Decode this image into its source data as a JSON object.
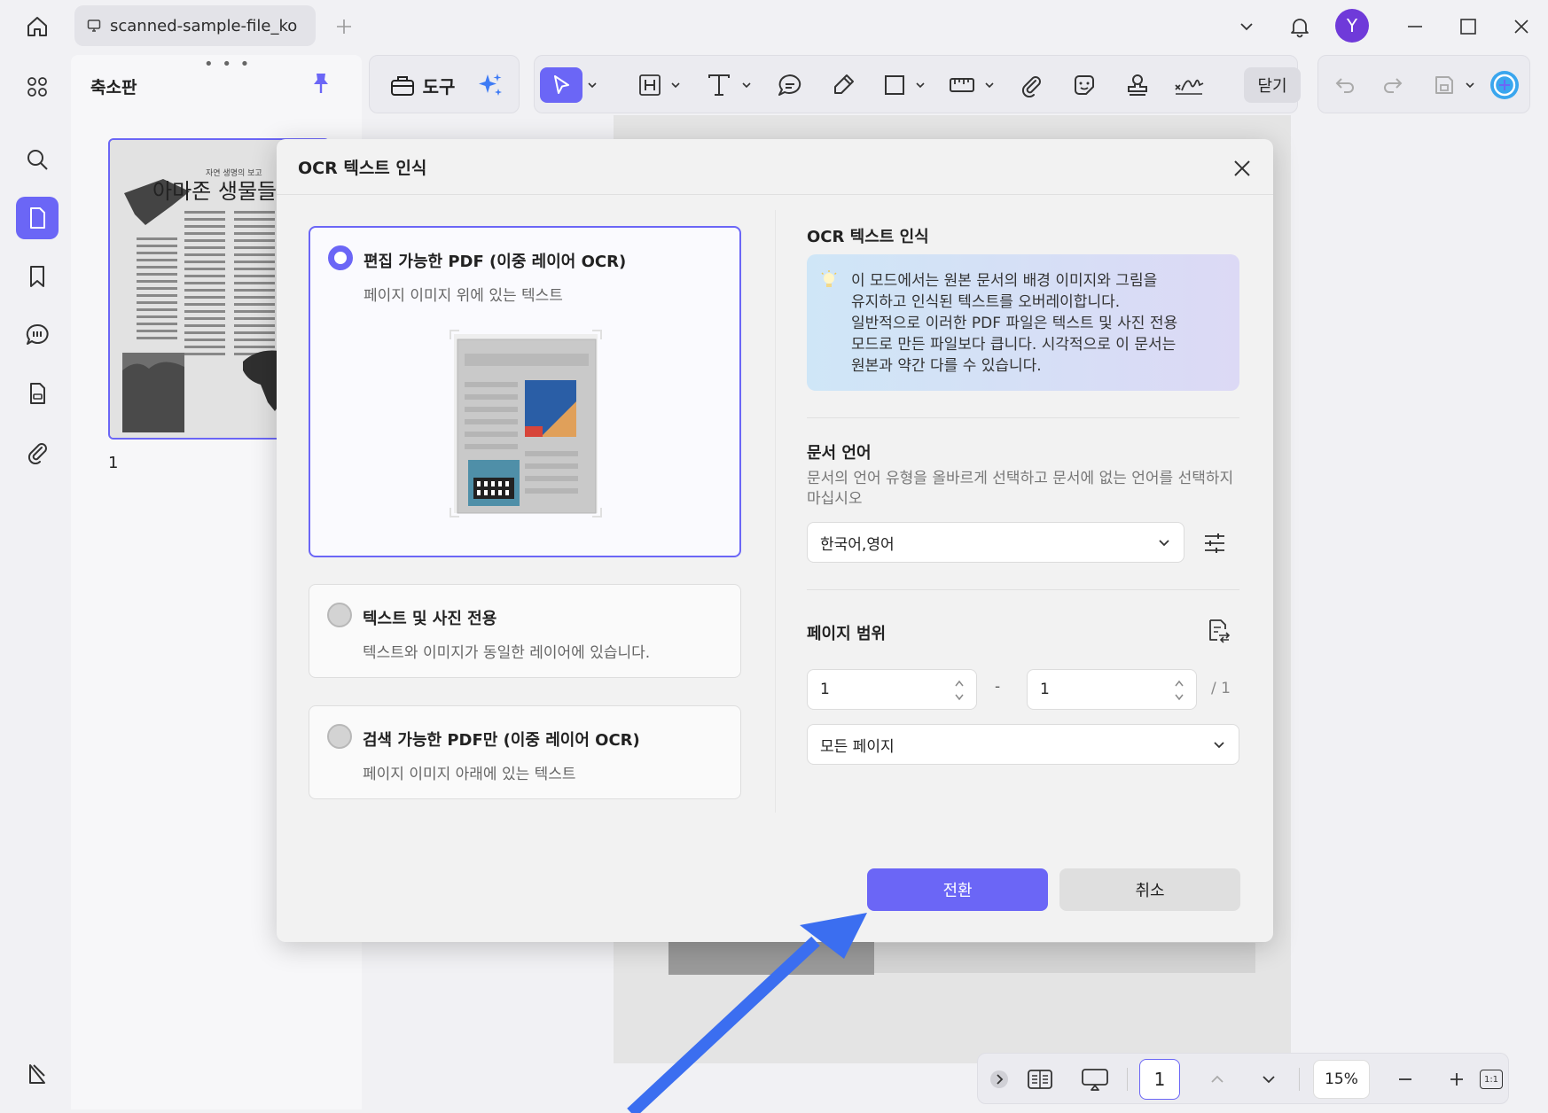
{
  "titlebar": {
    "tab_title": "scanned-sample-file_ko",
    "avatar_letter": "Y"
  },
  "thumbnails": {
    "title": "축소판",
    "page_title": "아마존 생물들",
    "page_subtitle": "자연 생명의 보고",
    "page_number": "1"
  },
  "toolbar": {
    "tools_label": "도구",
    "close_label": "닫기"
  },
  "dialog": {
    "title": "OCR 텍스트 인식",
    "options": [
      {
        "title": "편집 가능한 PDF (이중 레이어 OCR)",
        "desc": "페이지 이미지 위에 있는 텍스트",
        "selected": true
      },
      {
        "title": "텍스트 및 사진 전용",
        "desc": "텍스트와 이미지가 동일한 레이어에 있습니다.",
        "selected": false
      },
      {
        "title": "검색 가능한 PDF만 (이중 레이어 OCR)",
        "desc": "페이지 이미지 아래에 있는 텍스트",
        "selected": false
      }
    ],
    "ocr_section_title": "OCR 텍스트 인식",
    "info_line1": "이 모드에서는 원본 문서의 배경 이미지와 그림을",
    "info_line2": "유지하고 인식된 텍스트를 오버레이합니다.",
    "info_line3": "일반적으로 이러한 PDF 파일은 텍스트 및 사진 전용",
    "info_line4": "모드로 만든 파일보다 큽니다. 시각적으로 이 문서는",
    "info_line5": "원본과 약간 다를 수 있습니다.",
    "language_title": "문서 언어",
    "language_desc": "문서의 언어 유형을 올바르게 선택하고 문서에 없는 언어를 선택하지 마십시오",
    "language_value": "한국어,영어",
    "page_range_title": "페이지 범위",
    "range_from": "1",
    "range_dash": "-",
    "range_to": "1",
    "range_total": "/ 1",
    "page_filter": "모든 페이지",
    "convert_label": "전환",
    "cancel_label": "취소"
  },
  "bottombar": {
    "page_value": "1",
    "zoom": "15%",
    "fit_label": "1:1"
  },
  "colors": {
    "accent": "#6b66f6",
    "arrow": "#3b6ef0"
  }
}
